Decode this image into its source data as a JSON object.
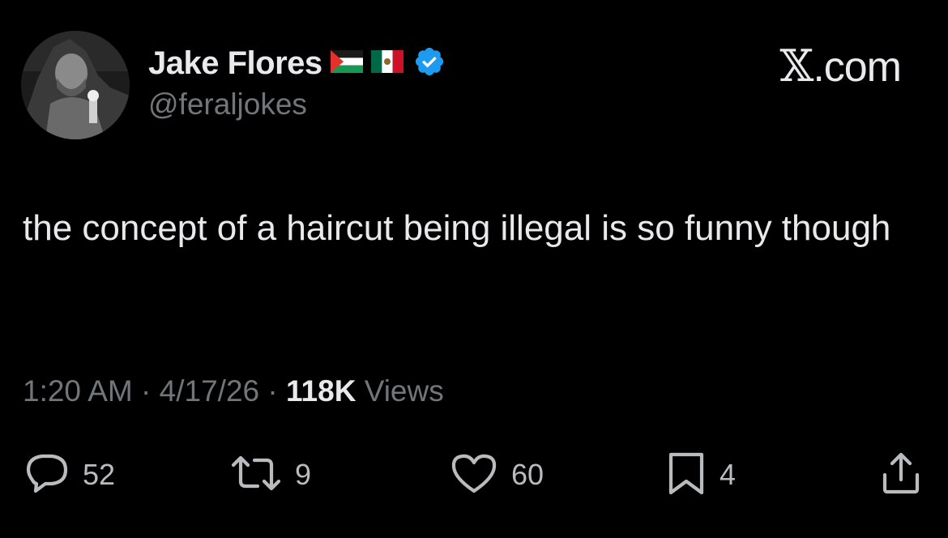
{
  "user": {
    "display_name": "Jake Flores",
    "handle": "@feraljokes",
    "flags": [
      "palestine-flag-icon",
      "mexico-flag-icon"
    ],
    "verified_badge": "verified-badge-icon",
    "verified_color": "#1d9bf0"
  },
  "site_label": {
    "glyph": "𝕏",
    "suffix": ".com"
  },
  "tweet": {
    "text": "the concept of a haircut being illegal is so funny though"
  },
  "meta": {
    "time": "1:20 AM",
    "separator": " · ",
    "date": "4/17/26",
    "views_count": "118K",
    "views_label": " Views"
  },
  "actions": {
    "replies": "52",
    "reposts": "9",
    "likes": "60",
    "bookmarks": "4"
  },
  "colors": {
    "background": "#000000",
    "primary_text": "#e7e9ea",
    "secondary_text": "#71767b"
  }
}
